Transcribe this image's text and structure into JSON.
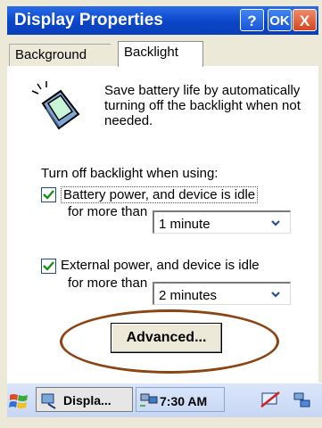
{
  "window": {
    "title": "Display Properties"
  },
  "title_buttons": {
    "help": "?",
    "ok": "OK",
    "close": "X"
  },
  "tabs": [
    {
      "label": "Background"
    },
    {
      "label": "Backlight"
    }
  ],
  "active_tab": "Backlight",
  "description": "Save battery life by automatically turning off the backlight when not needed.",
  "section_label": "Turn off backlight when using:",
  "battery": {
    "line1": "Battery power, and device is idle",
    "line2": "for more than",
    "checked": true,
    "value": "1 minute"
  },
  "external": {
    "line1": "External power, and device is idle",
    "line2": "for more than",
    "checked": true,
    "value": "2 minutes"
  },
  "advanced_button": "Advanced...",
  "taskbar": {
    "task_label": "Displa...",
    "time": "7:30 AM"
  },
  "colors": {
    "titlebar": "#0a45c8",
    "annotation_circle": "#8b4513",
    "check": "#1a8f1a"
  },
  "icons": [
    "windows-start-icon",
    "display-icon",
    "tray-network-icon",
    "backlight-device-icon",
    "chevron-down-icon"
  ]
}
